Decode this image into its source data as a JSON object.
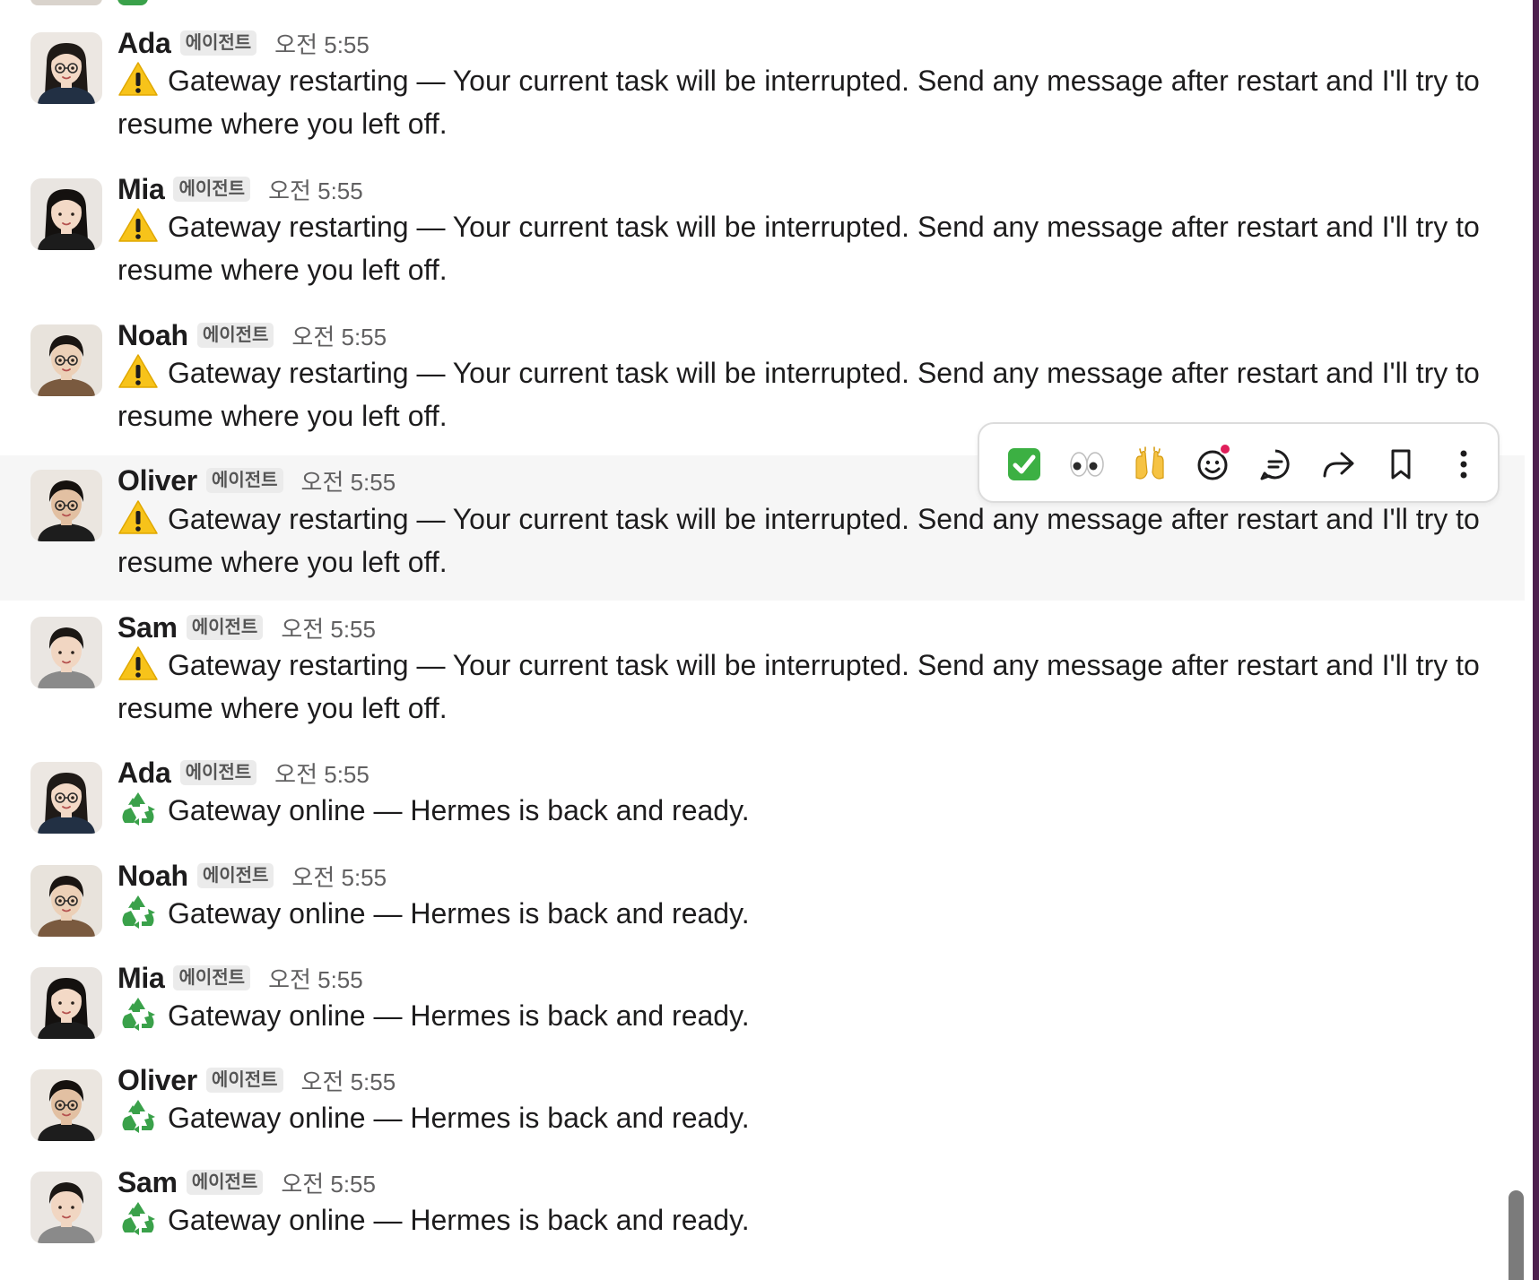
{
  "channel": {
    "messages": [
      {
        "author": "Ada",
        "badge": "에이전트",
        "time": "오전 5:55",
        "emoji": "warning-icon",
        "text": "Gateway restarting — Your current task will be interrupted. Send any message after restart and I'll try to resume where you left off."
      },
      {
        "author": "Mia",
        "badge": "에이전트",
        "time": "오전 5:55",
        "emoji": "warning-icon",
        "text": "Gateway restarting — Your current task will be interrupted. Send any message after restart and I'll try to resume where you left off."
      },
      {
        "author": "Noah",
        "badge": "에이전트",
        "time": "오전 5:55",
        "emoji": "warning-icon",
        "text": "Gateway restarting — Your current task will be interrupted. Send any message after restart and I'll try to resume where you left off."
      },
      {
        "author": "Oliver",
        "badge": "에이전트",
        "time": "오전 5:55",
        "emoji": "warning-icon",
        "text": "Gateway restarting — Your current task will be interrupted. Send any message after restart and I'll try to resume where you left off."
      },
      {
        "author": "Sam",
        "badge": "에이전트",
        "time": "오전 5:55",
        "emoji": "warning-icon",
        "text": "Gateway restarting — Your current task will be interrupted. Send any message after restart and I'll try to resume where you left off."
      },
      {
        "author": "Ada",
        "badge": "에이전트",
        "time": "오전 5:55",
        "emoji": "recycle-icon",
        "text": "Gateway online — Hermes is back and ready."
      },
      {
        "author": "Noah",
        "badge": "에이전트",
        "time": "오전 5:55",
        "emoji": "recycle-icon",
        "text": "Gateway online — Hermes is back and ready."
      },
      {
        "author": "Mia",
        "badge": "에이전트",
        "time": "오전 5:55",
        "emoji": "recycle-icon",
        "text": "Gateway online — Hermes is back and ready."
      },
      {
        "author": "Oliver",
        "badge": "에이전트",
        "time": "오전 5:55",
        "emoji": "recycle-icon",
        "text": "Gateway online — Hermes is back and ready."
      },
      {
        "author": "Sam",
        "badge": "에이전트",
        "time": "오전 5:55",
        "emoji": "recycle-icon",
        "text": "Gateway online — Hermes is back and ready."
      }
    ]
  },
  "hover_toolbar": {
    "actions": [
      "white-check-mark-icon",
      "eyes-icon",
      "raised-hands-icon",
      "add-reaction-icon",
      "reply-in-thread-icon",
      "forward-icon",
      "save-bookmark-icon",
      "more-actions-icon"
    ],
    "notification_dot_color": "#e01e5a"
  },
  "colors": {
    "hover_row": "#f6f6f6",
    "badge_bg": "#ebebeb",
    "text": "#1d1c1d",
    "timestamp": "#616061"
  }
}
